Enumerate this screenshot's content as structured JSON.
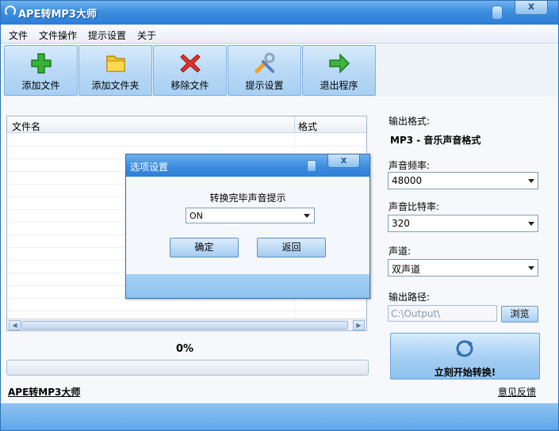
{
  "window": {
    "title": "APE转MP3大师",
    "close_label": "x"
  },
  "menu": [
    "文件",
    "文件操作",
    "提示设置",
    "关于"
  ],
  "toolbar": [
    {
      "label": "添加文件",
      "icon": "plus-icon"
    },
    {
      "label": "添加文件夹",
      "icon": "folder-icon"
    },
    {
      "label": "移除文件",
      "icon": "remove-x-icon"
    },
    {
      "label": "提示设置",
      "icon": "tools-icon"
    },
    {
      "label": "退出程序",
      "icon": "exit-arrow-icon"
    }
  ],
  "file_list": {
    "col_name": "文件名",
    "col_format": "格式"
  },
  "progress": {
    "text": "0%",
    "value": 0
  },
  "footer": {
    "left_link": "APE转MP3大师",
    "right_link": "意见反馈"
  },
  "output": {
    "format_label": "输出格式:",
    "format_value": "MP3 - 音乐声音格式",
    "freq_label": "声音频率:",
    "freq_value": "48000",
    "bitrate_label": "声音比特率:",
    "bitrate_value": "320",
    "channel_label": "声道:",
    "channel_value": "双声道",
    "path_label": "输出路径:",
    "path_value": "C:\\Output\\",
    "browse_label": "浏览",
    "convert_label": "立刻开始转换!"
  },
  "dialog": {
    "title": "选项设置",
    "close_label": "x",
    "prompt": "转换完毕声音提示",
    "select_value": "ON",
    "ok_label": "确定",
    "back_label": "返回"
  },
  "colors": {
    "accent": "#3d8fe0",
    "button": "#b9d9f6"
  }
}
